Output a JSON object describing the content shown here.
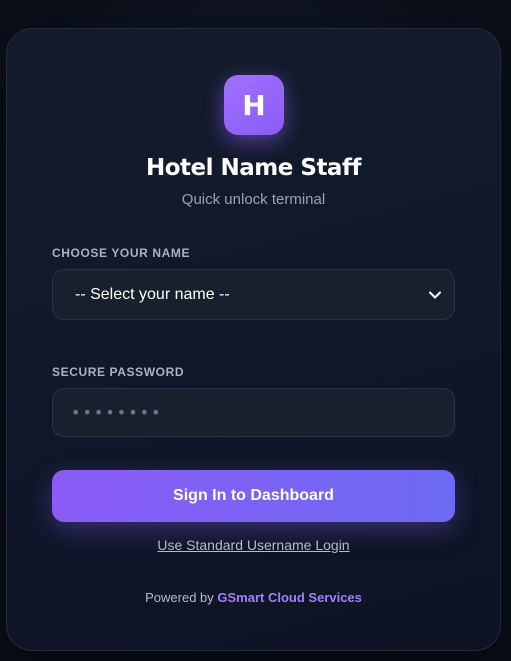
{
  "header": {
    "logo_letter": "H",
    "title": "Hotel Name Staff",
    "subtitle": "Quick unlock terminal"
  },
  "form": {
    "name_label": "CHOOSE YOUR NAME",
    "name_select_value": "-- Select your name --",
    "password_label": "SECURE PASSWORD",
    "password_placeholder": "••••••••",
    "submit_label": "Sign In to Dashboard",
    "alt_login_label": "Use Standard Username Login"
  },
  "footer": {
    "powered_prefix": "Powered by",
    "brand": "GSmart Cloud Services"
  },
  "colors": {
    "accent": "#8b5cf6",
    "accent_end": "#6d6af4",
    "background": "#0b0f1a",
    "card": "#141c2c"
  },
  "icons": {
    "select_arrow": "chevron-down-icon"
  }
}
